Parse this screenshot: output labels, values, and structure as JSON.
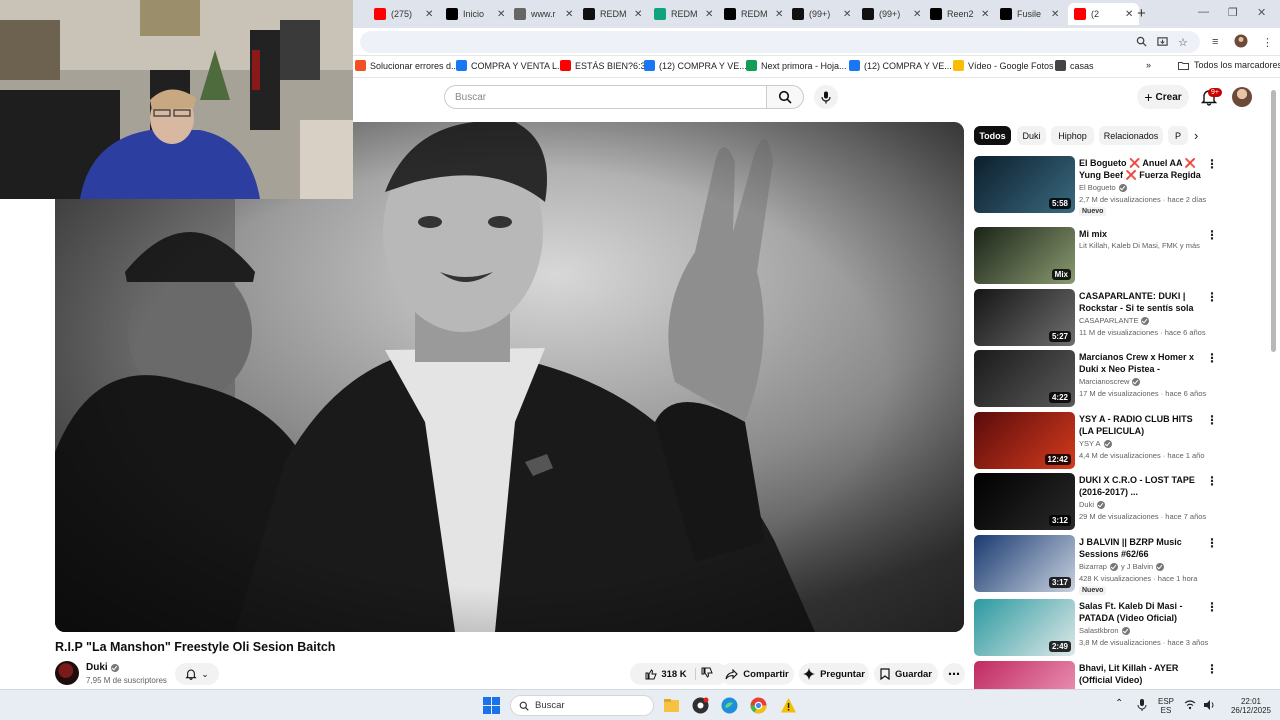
{
  "browser": {
    "tabs": [
      {
        "label": "(275)",
        "icon": "youtube-icon",
        "color": "#ff0000"
      },
      {
        "label": "Inicio",
        "icon": "x-icon",
        "color": "#000000"
      },
      {
        "label": "www.r",
        "icon": "globe-icon",
        "color": "#666666"
      },
      {
        "label": "REDM",
        "icon": "tiktok-icon",
        "color": "#111111"
      },
      {
        "label": "REDM",
        "icon": "chatgpt-icon",
        "color": "#10a37f"
      },
      {
        "label": "REDM",
        "icon": "x-icon",
        "color": "#000000"
      },
      {
        "label": "(99+)",
        "icon": "tiktok-icon",
        "color": "#111111"
      },
      {
        "label": "(99+)",
        "icon": "tiktok-icon",
        "color": "#111111"
      },
      {
        "label": "Reen2",
        "icon": "x-icon",
        "color": "#000000"
      },
      {
        "label": "Fusile",
        "icon": "x-icon",
        "color": "#000000"
      },
      {
        "label": "(2",
        "icon": "youtube-icon",
        "color": "#ff0000"
      }
    ],
    "bookmarks": [
      {
        "label": "Solucionar errores d...",
        "color": "#f25022"
      },
      {
        "label": "COMPRA Y VENTA L...",
        "color": "#1877f2"
      },
      {
        "label": "ESTÁS BIEN?6:33",
        "color": "#ff0000"
      },
      {
        "label": "(12) COMPRA Y VE...",
        "color": "#1877f2"
      },
      {
        "label": "Next primora - Hoja...",
        "color": "#0f9d58"
      },
      {
        "label": "(12) COMPRA Y VE...",
        "color": "#1877f2"
      },
      {
        "label": "Vídeo - Google Fotos",
        "color": "#fbbc04"
      },
      {
        "label": "casas",
        "color": "#444444"
      }
    ],
    "bookmarks_more": "»",
    "all_bookmarks": "Todos los marcadores"
  },
  "youtube": {
    "search_placeholder": "Buscar",
    "create_label": "Crear",
    "notifications_badge": "9+",
    "video": {
      "title": "R.I.P \"La Manshon\" Freestyle Oli Sesion Baitch",
      "channel": "Duki",
      "subscribers": "7,95 M de suscriptores",
      "likes": "318 K",
      "share": "Compartir",
      "ask": "Preguntar",
      "save": "Guardar"
    },
    "chips": [
      "Todos",
      "Duki",
      "Hiphop",
      "Relacionados",
      "P"
    ],
    "recommendations": [
      {
        "title": "El Bogueto ❌ Anuel AA ❌ Yung Beef ❌ Fuerza Regida - ...",
        "channel": "El Bogueto",
        "meta": "2,7 M de visualizaciones · hace 2 días",
        "duration": "5:58",
        "badge": "Nuevo",
        "colors": [
          "#0c1e2c",
          "#3a6a80"
        ]
      },
      {
        "title": "Mi mix",
        "channel": "Lit Killah, Kaleb Di Masi, FMK y más",
        "meta": "",
        "duration": "Mix",
        "badge": "",
        "colors": [
          "#1a2418",
          "#8a9a70"
        ]
      },
      {
        "title": "CASAPARLANTE: DUKI | Rockstar - Si te sentís sola ...",
        "channel": "CASAPARLANTE",
        "meta": "11 M de visualizaciones · hace 6 años",
        "duration": "5:27",
        "badge": "",
        "colors": [
          "#151515",
          "#6e6e6e"
        ]
      },
      {
        "title": "Marcianos Crew x Homer x Duki x Neo Pistea - COLOMBIANA ...",
        "channel": "Marcianoscrew",
        "meta": "17 M de visualizaciones · hace 6 años",
        "duration": "4:22",
        "badge": "",
        "colors": [
          "#1a1a1a",
          "#5a5a5a"
        ]
      },
      {
        "title": "YSY A - RADIO CLUB HITS (LA PELICULA)",
        "channel": "YSY A",
        "meta": "4,4 M de visualizaciones · hace 1 año",
        "duration": "12:42",
        "badge": "",
        "colors": [
          "#5a0c0c",
          "#d43a1c"
        ]
      },
      {
        "title": "DUKI X C.R.O - LOST TAPE (2016-2017)  ...",
        "channel": "Duki",
        "meta": "29 M de visualizaciones · hace 7 años",
        "duration": "3:12",
        "badge": "",
        "colors": [
          "#000000",
          "#2a2a2a"
        ]
      },
      {
        "title": "J BALVIN || BZRP Music Sessions #62/66",
        "channel": "Bizarrap",
        "channel_extra": "y J Balvin",
        "meta": "428 K visualizaciones · hace 1 hora",
        "duration": "3:17",
        "badge": "Nuevo",
        "colors": [
          "#1a3a70",
          "#c8d2e0"
        ]
      },
      {
        "title": "Salas Ft. Kaleb Di Masi - PATADA (Video Oficial)",
        "channel": "Salastkbron",
        "meta": "3,8 M de visualizaciones · hace 3 años",
        "duration": "2:49",
        "badge": "",
        "colors": [
          "#2a9aa0",
          "#e0e8e8"
        ]
      },
      {
        "title": "Bhavi, Lit Killah - AYER (Official Video)",
        "channel": "",
        "meta": "",
        "duration": "",
        "badge": "",
        "colors": [
          "#c02a60",
          "#f0a0c0"
        ]
      }
    ]
  },
  "taskbar": {
    "search_placeholder": "Buscar",
    "lang": "ESP",
    "lang_sub": "ES",
    "time": "22:01",
    "date": "26/12/2025"
  }
}
